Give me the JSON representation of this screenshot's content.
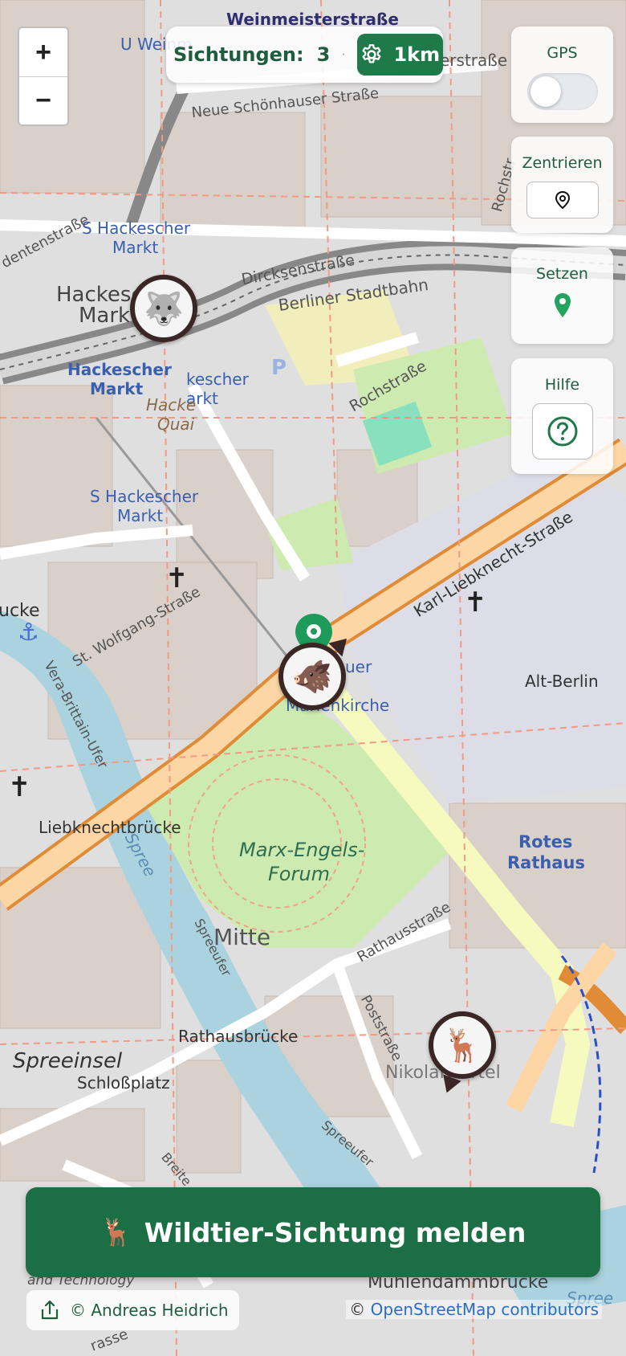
{
  "zoom": {
    "in_label": "+",
    "out_label": "−"
  },
  "topbar": {
    "sightings_label": "Sichtungen:",
    "sightings_count": "3",
    "separator": "·",
    "radius_label": "1km"
  },
  "panels": {
    "gps": {
      "title": "GPS",
      "enabled": false
    },
    "center": {
      "title": "Zentrieren"
    },
    "set": {
      "title": "Setzen"
    },
    "help": {
      "title": "Hilfe"
    }
  },
  "markers": [
    {
      "animal": "wolf",
      "emoji": "🐺"
    },
    {
      "animal": "wild boar",
      "emoji": "🐗"
    },
    {
      "animal": "deer",
      "emoji": "🦌"
    }
  ],
  "cta": {
    "emoji": "🦌",
    "label": "Wildtier-Sichtung melden"
  },
  "credit": {
    "label": "© Andreas Heidrich"
  },
  "attribution": {
    "prefix": "©",
    "link": "OpenStreetMap contributors"
  },
  "map_labels": {
    "weinmeisterstrasse": "Weinmeisterstraße",
    "u_weinm": "U Weinm",
    "erstrasse": "erstraße",
    "neue_schoenhauser": "Neue Schönhauser Straße",
    "s_hackescher_top": "S Hackescher",
    "markt_top": "Markt",
    "dentenstrasse": "dentenstraße",
    "hackesch": "Hackesch",
    "markt_1": "Markt",
    "dircksenstrasse": "Dircksenstraße",
    "berliner_stadtbahn": "Berliner Stadtbahn",
    "hackescher_markt_blue": "Hackescher",
    "markt_blue": "Markt",
    "kescher": "kescher",
    "arkt": "arkt",
    "hacke_quai": "Hacke",
    "quai": "Quai",
    "rochstrasse": "Rochstraße",
    "rochstr_top": "Rochstr",
    "s_hackescher_2": "S Hackescher",
    "markt_2": "Markt",
    "karl_liebknecht": "Karl-Liebknecht-Straße",
    "ucke": "ucke",
    "st_wolfgang": "St. Wolfgang-Straße",
    "vera_brittain": "Vera-Brittain-Ufer",
    "alt_berlin": "Alt-Berlin",
    "uer": "uer",
    "marienkirche": "Marienkirche",
    "liebknechtbruecke": "Liebknechtbrücke",
    "spree": "Spree",
    "marx_engels": "Marx-Engels-",
    "forum": "Forum",
    "rotes": "Rotes",
    "rathaus": "Rathaus",
    "mitte": "Mitte",
    "rathausstrasse": "Rathausstraße",
    "spreeufer_1": "Spreeufer",
    "poststrasse": "Poststraße",
    "rathausbruecke": "Rathausbrücke",
    "spreeinsel": "Spreeinsel",
    "schlossplatz": "Schloßplatz",
    "nikolaiviertel": "Nikolaiviertel",
    "spreeufer_2": "Spreeufer",
    "breite": "Breite",
    "and_technology": "and Technology",
    "muehlendamm": "Mühlendammbrücke",
    "spree_2": "Spree",
    "strasse_bottom": "rasse"
  }
}
